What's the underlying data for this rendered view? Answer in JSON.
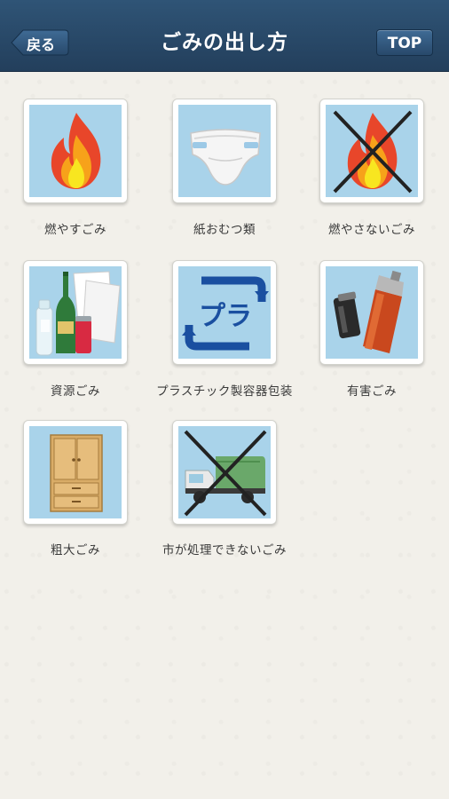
{
  "header": {
    "title": "ごみの出し方",
    "back_label": "戻る",
    "top_label": "TOP"
  },
  "categories": [
    {
      "label": "燃やすごみ",
      "icon": "fire-icon"
    },
    {
      "label": "紙おむつ類",
      "icon": "diaper-icon"
    },
    {
      "label": "燃やさないごみ",
      "icon": "fire-crossed-icon"
    },
    {
      "label": "資源ごみ",
      "icon": "recyclables-icon"
    },
    {
      "label": "プラスチック製容器包装",
      "icon": "plastic-recycle-icon"
    },
    {
      "label": "有害ごみ",
      "icon": "battery-lighter-icon"
    },
    {
      "label": "粗大ごみ",
      "icon": "furniture-icon"
    },
    {
      "label": "市が処理できないごみ",
      "icon": "garbage-truck-crossed-icon"
    }
  ],
  "colors": {
    "header": "#2a4a6b",
    "tile_bg": "#a9d3ea",
    "paper": "#f2f0ea"
  }
}
